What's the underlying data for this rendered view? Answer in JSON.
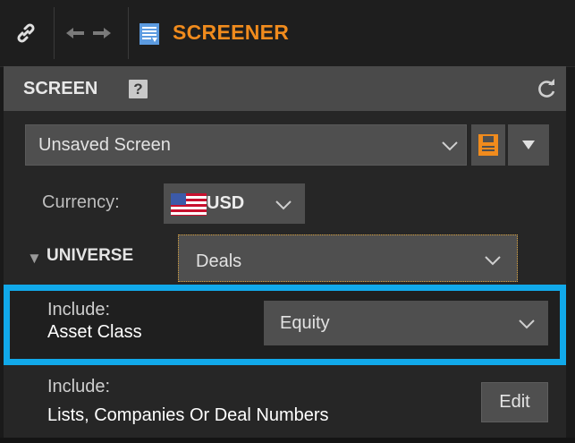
{
  "titlebar": {
    "title": "SCREENER",
    "title_color": "#f08b1d",
    "icons": [
      "link-icon",
      "back-arrow-icon",
      "forward-arrow-icon",
      "screener-grid-icon"
    ]
  },
  "screen_section": {
    "label": "SCREEN",
    "help_icon_text": "?",
    "refresh_icon": "refresh-icon",
    "screen_select": {
      "value": "Unsaved Screen"
    },
    "save_icon": "save-icon",
    "menu_icon": "triangle-down-icon"
  },
  "currency": {
    "label": "Currency:",
    "value": "USD",
    "flag_icon": "us-flag-icon"
  },
  "universe": {
    "toggle_glyph": "▼",
    "label": "UNIVERSE",
    "select_value": "Deals"
  },
  "asset_class": {
    "label_line1": "Include:",
    "label_line2": "Asset Class",
    "select_value": "Equity",
    "highlight_color": "#11a9ea"
  },
  "lists": {
    "label_line1": "Include:",
    "label_line2": "Lists, Companies Or Deal Numbers",
    "edit_label": "Edit"
  }
}
